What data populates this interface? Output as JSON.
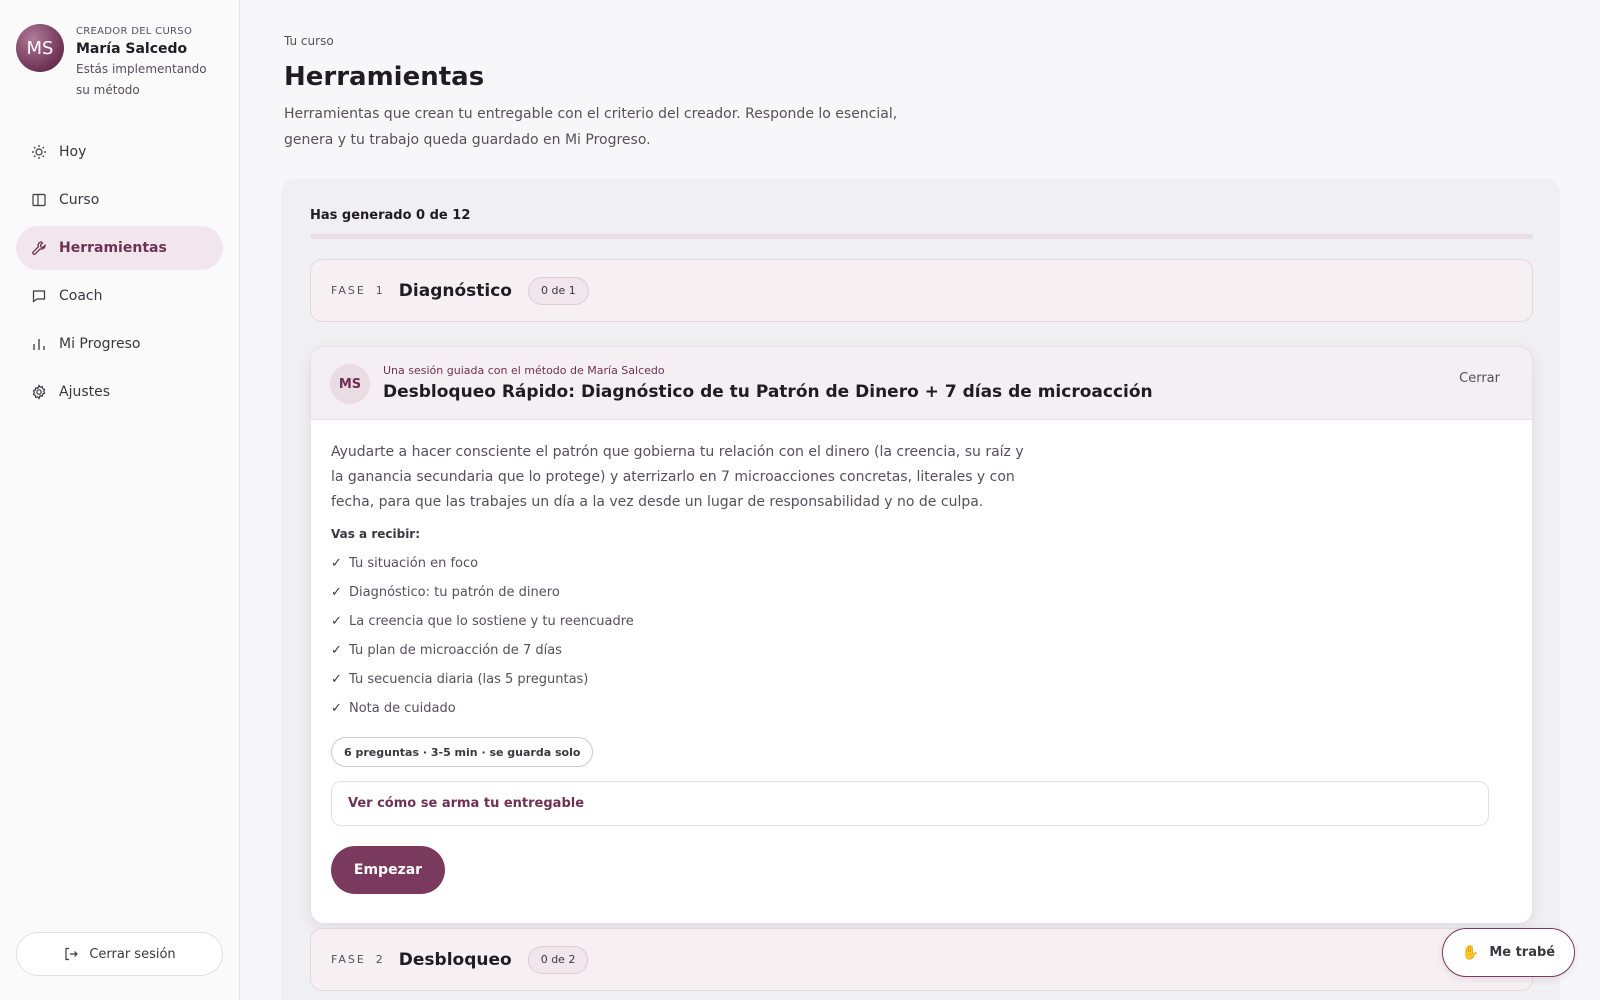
{
  "creator": {
    "initials": "MS",
    "kicker": "CREADOR DEL CURSO",
    "name": "María Salcedo",
    "subtitle": "Estás implementando su método"
  },
  "nav": [
    {
      "label": "Hoy",
      "icon": "sun-icon"
    },
    {
      "label": "Curso",
      "icon": "book-icon"
    },
    {
      "label": "Herramientas",
      "icon": "wrench-icon",
      "active": true
    },
    {
      "label": "Coach",
      "icon": "chat-icon"
    },
    {
      "label": "Mi Progreso",
      "icon": "bar-chart-icon"
    },
    {
      "label": "Ajustes",
      "icon": "gear-icon"
    }
  ],
  "logout_label": "Cerrar sesión",
  "page": {
    "crumb": "Tu curso",
    "title": "Herramientas",
    "description": "Herramientas que crean tu entregable con el criterio del creador. Responde lo esencial, genera y tu trabajo queda guardado en Mi Progreso."
  },
  "progress": {
    "label": "Has generado 0 de 12",
    "generated": 0,
    "total": 12
  },
  "phases": [
    {
      "kicker": "FASE",
      "number": "1",
      "title": "Diagnóstico",
      "badge": "0 de 1"
    },
    {
      "kicker": "FASE",
      "number": "2",
      "title": "Desbloqueo",
      "badge": "0 de 2"
    }
  ],
  "tool": {
    "avatar": "MS",
    "kicker": "Una sesión guiada con el método de María Salcedo",
    "title": "Desbloqueo Rápido: Diagnóstico de tu Patrón de Dinero + 7 días de microacción",
    "close_label": "Cerrar",
    "description": "Ayudarte a hacer consciente el patrón que gobierna tu relación con el dinero (la creencia, su raíz y la ganancia secundaria que lo protege) y aterrizarlo en 7 microacciones concretas, literales y con fecha, para que las trabajes un día a la vez desde un lugar de responsabilidad y no de culpa.",
    "receive_label": "Vas a recibir:",
    "check_glyph": "✓",
    "deliverables": [
      "Tu situación en foco",
      "Diagnóstico: tu patrón de dinero",
      "La creencia que lo sostiene y tu reencuadre",
      "Tu plan de microacción de 7 días",
      "Tu secuencia diaria (las 5 preguntas)",
      "Nota de cuidado"
    ],
    "meta": "6 preguntas · 3-5 min · se guarda solo",
    "expander_label": "Ver cómo se arma tu entregable",
    "start_label": "Empezar"
  },
  "help_button": {
    "icon": "hand-icon",
    "glyph": "✋",
    "label": "Me trabé"
  },
  "colors": {
    "accent": "#6e3154",
    "button": "#7a3a5e",
    "active_bg": "#f1e6ec"
  }
}
